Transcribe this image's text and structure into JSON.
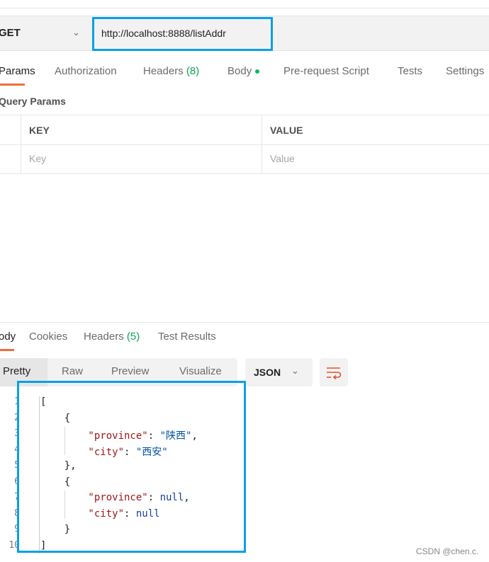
{
  "request": {
    "method": "GET",
    "url": "http://localhost:8888/listAddr"
  },
  "request_tabs": [
    {
      "label": "Params"
    },
    {
      "label": "Authorization"
    },
    {
      "label": "Headers",
      "count": "(8)"
    },
    {
      "label": "Body"
    },
    {
      "label": "Pre-request Script"
    },
    {
      "label": "Tests"
    },
    {
      "label": "Settings"
    }
  ],
  "query_params": {
    "title": "Query Params",
    "columns": [
      "KEY",
      "VALUE"
    ],
    "placeholders": [
      "Key",
      "Value"
    ]
  },
  "response_tabs": [
    {
      "label": "ody"
    },
    {
      "label": "Cookies"
    },
    {
      "label": "Headers",
      "count": "(5)"
    },
    {
      "label": "Test Results"
    }
  ],
  "view_modes": [
    "Pretty",
    "Raw",
    "Preview",
    "Visualize"
  ],
  "format": "JSON",
  "code": {
    "line_numbers": [
      "1",
      "2",
      "3",
      "4",
      "5",
      "6",
      "7",
      "8",
      "9",
      "10"
    ],
    "lines": [
      [
        [
          "p",
          "["
        ]
      ],
      [
        [
          "p",
          "    {"
        ]
      ],
      [
        [
          "k",
          "        \"province\""
        ],
        [
          "p",
          ": "
        ],
        [
          "s",
          "\"陕西\""
        ],
        [
          "p",
          ","
        ]
      ],
      [
        [
          "k",
          "        \"city\""
        ],
        [
          "p",
          ": "
        ],
        [
          "s",
          "\"西安\""
        ]
      ],
      [
        [
          "p",
          "    },"
        ]
      ],
      [
        [
          "p",
          "    {"
        ]
      ],
      [
        [
          "k",
          "        \"province\""
        ],
        [
          "p",
          ": "
        ],
        [
          "n",
          "null"
        ],
        [
          "p",
          ","
        ]
      ],
      [
        [
          "k",
          "        \"city\""
        ],
        [
          "p",
          ": "
        ],
        [
          "n",
          "null"
        ]
      ],
      [
        [
          "p",
          "    }"
        ]
      ],
      [
        [
          "p",
          "]"
        ]
      ]
    ]
  },
  "watermark": "CSDN @chen.c.",
  "colors": {
    "accent": "#f26b3a",
    "highlight_box": "#0aa0e6",
    "count_green": "#0ca451"
  }
}
